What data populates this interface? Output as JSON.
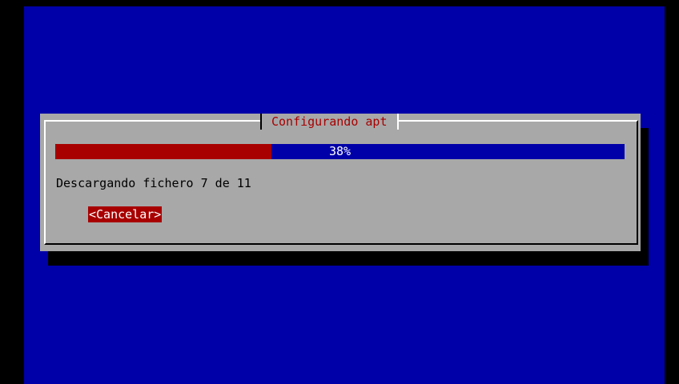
{
  "dialog": {
    "title": "Configurando apt",
    "progress": {
      "fraction": 0.38,
      "label": "38%"
    },
    "status_text": "Descargando fichero 7 de 11",
    "cancel_label": "<Cancelar>"
  },
  "colors": {
    "background": "#0000a8",
    "dialog": "#a8a8a8",
    "accent": "#a80000",
    "progress_remaining": "#0000a8"
  }
}
